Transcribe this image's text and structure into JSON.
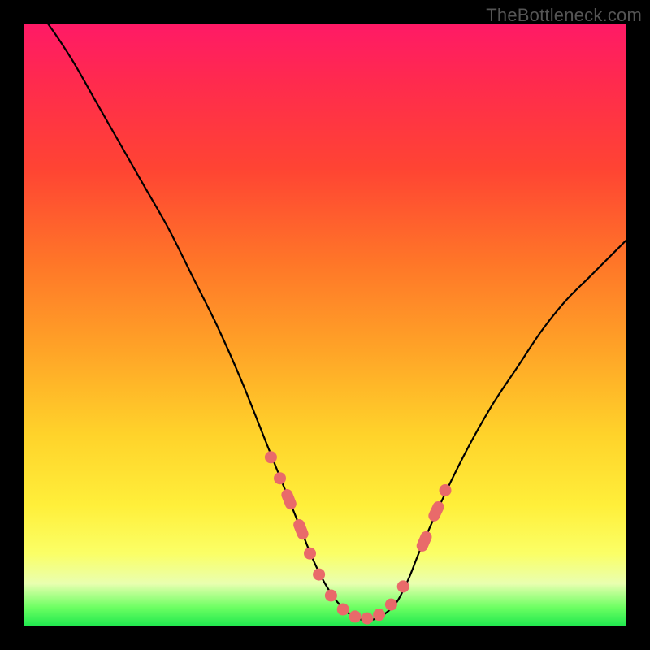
{
  "attribution": "TheBottleneck.com",
  "chart_data": {
    "type": "line",
    "title": "",
    "xlabel": "",
    "ylabel": "",
    "xlim": [
      0,
      100
    ],
    "ylim": [
      0,
      100
    ],
    "grid": false,
    "series": [
      {
        "name": "curve",
        "x": [
          0,
          4,
          8,
          12,
          16,
          20,
          24,
          28,
          32,
          36,
          40,
          42,
          44,
          46,
          48,
          50,
          52,
          54,
          56,
          58,
          60,
          62,
          64,
          66,
          70,
          74,
          78,
          82,
          86,
          90,
          94,
          98,
          100
        ],
        "y": [
          105,
          100,
          94,
          87,
          80,
          73,
          66,
          58,
          50,
          41,
          31,
          26,
          21,
          16,
          11,
          7,
          4,
          2,
          1,
          1,
          2,
          4,
          8,
          13,
          22,
          30,
          37,
          43,
          49,
          54,
          58,
          62,
          64
        ]
      }
    ],
    "markers": [
      {
        "x": 41.0,
        "y": 28.0,
        "shape": "circle"
      },
      {
        "x": 42.5,
        "y": 24.5,
        "shape": "circle"
      },
      {
        "x": 44.0,
        "y": 21.0,
        "shape": "pill"
      },
      {
        "x": 46.0,
        "y": 16.0,
        "shape": "pill"
      },
      {
        "x": 47.5,
        "y": 12.0,
        "shape": "circle"
      },
      {
        "x": 49.0,
        "y": 8.5,
        "shape": "circle"
      },
      {
        "x": 51.0,
        "y": 5.0,
        "shape": "circle"
      },
      {
        "x": 53.0,
        "y": 2.7,
        "shape": "circle"
      },
      {
        "x": 55.0,
        "y": 1.5,
        "shape": "circle"
      },
      {
        "x": 57.0,
        "y": 1.2,
        "shape": "circle"
      },
      {
        "x": 59.0,
        "y": 1.8,
        "shape": "circle"
      },
      {
        "x": 61.0,
        "y": 3.5,
        "shape": "circle"
      },
      {
        "x": 63.0,
        "y": 6.5,
        "shape": "circle"
      },
      {
        "x": 66.5,
        "y": 14.0,
        "shape": "pill"
      },
      {
        "x": 68.5,
        "y": 19.0,
        "shape": "pill"
      },
      {
        "x": 70.0,
        "y": 22.5,
        "shape": "circle"
      }
    ],
    "colors": {
      "curve": "#000000",
      "marker": "#e96a6a"
    }
  }
}
